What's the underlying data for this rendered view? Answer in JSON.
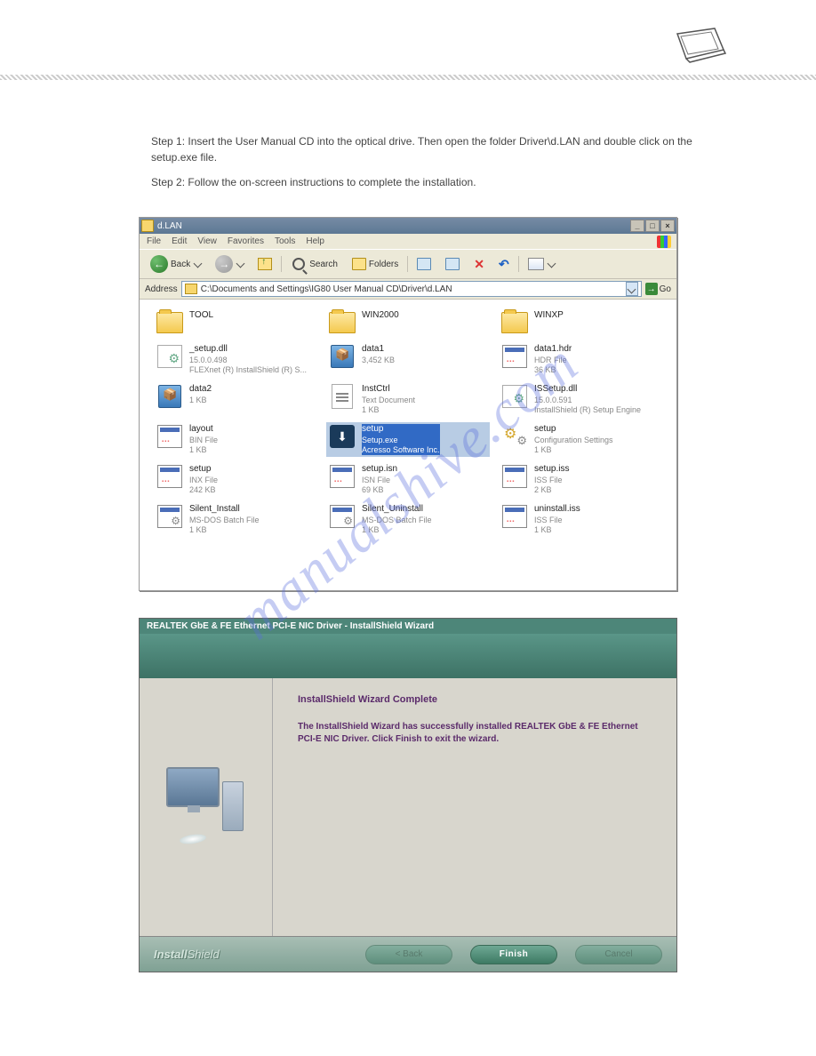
{
  "intro": {
    "step1": "Step 1: Insert the User Manual CD into the optical drive. Then open the folder Driver\\d.LAN and double click on the setup.exe file.",
    "step2": "Step 2: Follow the on-screen instructions to complete the installation."
  },
  "explorer": {
    "title": "d.LAN",
    "menu": {
      "file": "File",
      "edit": "Edit",
      "view": "View",
      "favorites": "Favorites",
      "tools": "Tools",
      "help": "Help"
    },
    "toolbar": {
      "back": "Back",
      "search": "Search",
      "folders": "Folders"
    },
    "address_label": "Address",
    "address_value": "C:\\Documents and Settings\\IG80 User Manual CD\\Driver\\d.LAN",
    "go": "Go",
    "files": [
      {
        "icon": "folder",
        "name": "TOOL",
        "sub1": "",
        "sub2": ""
      },
      {
        "icon": "folder",
        "name": "WIN2000",
        "sub1": "",
        "sub2": ""
      },
      {
        "icon": "folder",
        "name": "WINXP",
        "sub1": "",
        "sub2": ""
      },
      {
        "icon": "dll",
        "name": "_setup.dll",
        "sub1": "15.0.0.498",
        "sub2": "FLEXnet (R) InstallShield (R) S..."
      },
      {
        "icon": "cab",
        "name": "data1",
        "sub1": "3,452 KB",
        "sub2": ""
      },
      {
        "icon": "doc",
        "name": "data1.hdr",
        "sub1": "HDR File",
        "sub2": "36 KB"
      },
      {
        "icon": "cab",
        "name": "data2",
        "sub1": "1 KB",
        "sub2": ""
      },
      {
        "icon": "txt",
        "name": "InstCtrl",
        "sub1": "Text Document",
        "sub2": "1 KB"
      },
      {
        "icon": "dll",
        "name": "ISSetup.dll",
        "sub1": "15.0.0.591",
        "sub2": "InstallShield (R) Setup Engine"
      },
      {
        "icon": "doc",
        "name": "layout",
        "sub1": "BIN File",
        "sub2": "1 KB"
      },
      {
        "icon": "exe",
        "name": "setup",
        "sub1": "Setup.exe",
        "sub2": "Acresso Software Inc.",
        "selected": true
      },
      {
        "icon": "gear",
        "name": "setup",
        "sub1": "Configuration Settings",
        "sub2": "1 KB"
      },
      {
        "icon": "doc",
        "name": "setup",
        "sub1": "INX File",
        "sub2": "242 KB"
      },
      {
        "icon": "doc",
        "name": "setup.isn",
        "sub1": "ISN File",
        "sub2": "69 KB"
      },
      {
        "icon": "doc",
        "name": "setup.iss",
        "sub1": "ISS File",
        "sub2": "2 KB"
      },
      {
        "icon": "bat",
        "name": "Silent_Install",
        "sub1": "MS-DOS Batch File",
        "sub2": "1 KB"
      },
      {
        "icon": "bat",
        "name": "Silent_Uninstall",
        "sub1": "MS-DOS Batch File",
        "sub2": "1 KB"
      },
      {
        "icon": "doc",
        "name": "uninstall.iss",
        "sub1": "ISS File",
        "sub2": "1 KB"
      }
    ]
  },
  "wizard": {
    "title": "REALTEK GbE & FE Ethernet PCI-E NIC Driver - InstallShield Wizard",
    "heading": "InstallShield Wizard Complete",
    "body": "The InstallShield Wizard has successfully installed REALTEK GbE & FE Ethernet PCI-E NIC Driver.  Click Finish to exit the wizard.",
    "logo_a": "Install",
    "logo_b": "Shield",
    "btn_back": "< Back",
    "btn_finish": "Finish",
    "btn_cancel": "Cancel"
  },
  "watermark": "manualshive.com"
}
